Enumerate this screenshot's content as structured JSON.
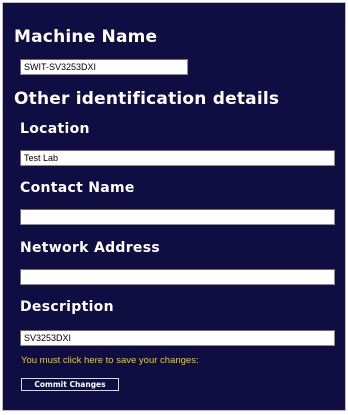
{
  "machine": {
    "heading": "Machine Name",
    "value": "SWIT-SV3253DXI"
  },
  "other": {
    "heading": "Other identification details"
  },
  "location": {
    "label": "Location",
    "value": "Test Lab"
  },
  "contact": {
    "label": "Contact Name",
    "value": ""
  },
  "network": {
    "label": "Network Address",
    "value": ""
  },
  "description": {
    "label": "Description",
    "value": "SV3253DXI"
  },
  "save": {
    "hint": "You must click here to save your changes:",
    "button_label": "Commit Changes"
  }
}
